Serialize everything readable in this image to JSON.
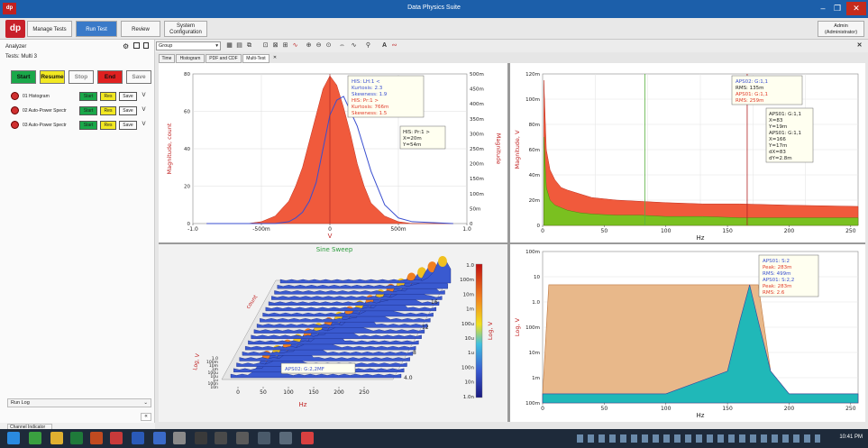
{
  "window": {
    "title": "Data Physics Suite",
    "logo": "dp"
  },
  "toolbar": {
    "tabs": [
      "Manage Tests",
      "Run Test",
      "Review",
      "System\nConfiguration"
    ],
    "admin": "Admin\n(Administrator)"
  },
  "left": {
    "analyzer": "Analyzer",
    "tests": "Tests: Multi 3",
    "buttons": {
      "start": "Start",
      "resume": "Resume",
      "stop": "Stop",
      "end": "End",
      "save": "Save"
    },
    "rows": [
      {
        "name": "01 Histogram",
        "run": "Start",
        "res": "Res",
        "save": "Save",
        "v": "V"
      },
      {
        "name": "02 Auto-Power Spectr",
        "run": "Start",
        "res": "Res",
        "save": "Save",
        "v": "V"
      },
      {
        "name": "03 Auto-Power Spectr",
        "run": "Start",
        "res": "Res",
        "save": "Save",
        "v": "V"
      }
    ],
    "run_log": "Run Log",
    "channel_indicator": "Channel Indicator"
  },
  "subtoolbar": {
    "group": "Group"
  },
  "view_tabs": [
    "Time",
    "Histogram",
    "PDF and CDF",
    "Multi-Test"
  ],
  "colors": {
    "hist": "#f05a3c",
    "blue": "#3a4fd0",
    "green": "#7ac020",
    "tan": "#e8b88a",
    "teal": "#20b8b8"
  },
  "chart_data": [
    {
      "type": "area",
      "xlabel": "V",
      "ylabel": "Magnitude, count",
      "y2label": "Magnitude",
      "xlim": [
        -1.0,
        1.0
      ],
      "ylim": [
        0,
        80
      ],
      "xticks": [
        "-1.0",
        "-500m",
        "0",
        "500m",
        "1.0"
      ],
      "yticks": [
        "0",
        "20",
        "40",
        "60",
        "80"
      ],
      "y2ticks": [
        "0",
        "50m",
        "100m",
        "150m",
        "200m",
        "250m",
        "300m",
        "350m",
        "400m",
        "450m",
        "500m"
      ],
      "legend": [
        {
          "label": "HIS: LH:1 <",
          "color": "#3a4fd0"
        },
        {
          "label": "Kurtosis: 2.3",
          "color": "#3a4fd0"
        },
        {
          "label": "Skewness: 1.9",
          "color": "#3a4fd0"
        },
        {
          "label": "HIS: Pr:1 >",
          "color": "#e03a2a"
        },
        {
          "label": "Kurtosis: 766m",
          "color": "#e03a2a"
        },
        {
          "label": "Skewness: 1.5",
          "color": "#e03a2a"
        }
      ],
      "cursor": [
        "HIS: Pr:1 >",
        "X=20m",
        "Y=54m"
      ],
      "x": [
        -0.9,
        -0.6,
        -0.5,
        -0.4,
        -0.3,
        -0.25,
        -0.2,
        -0.15,
        -0.1,
        -0.05,
        0,
        0.05,
        0.1,
        0.15,
        0.2,
        0.25,
        0.3,
        0.4,
        0.5,
        0.6,
        0.9
      ],
      "series": [
        {
          "name": "HIS: Pr:1",
          "values": [
            0,
            0,
            1,
            4,
            12,
            20,
            30,
            44,
            58,
            72,
            79,
            74,
            62,
            48,
            32,
            20,
            11,
            4,
            1,
            0,
            0
          ]
        },
        {
          "name": "HIS: LH:1",
          "values": [
            0,
            0,
            0,
            0,
            1,
            3,
            6,
            12,
            22,
            40,
            58,
            66,
            68,
            60,
            52,
            40,
            28,
            10,
            3,
            1,
            0
          ]
        }
      ]
    },
    {
      "type": "line",
      "xlabel": "Hz",
      "ylabel": "Magnitude, V",
      "xlim": [
        0,
        256
      ],
      "ylim": [
        0,
        120
      ],
      "xticks": [
        "0",
        "50",
        "100",
        "150",
        "200",
        "250"
      ],
      "yticks": [
        "0",
        "20m",
        "40m",
        "60m",
        "80m",
        "100m",
        "120m"
      ],
      "legend": [
        {
          "label": "APS02: G:1,1",
          "color": "#3a4fd0"
        },
        {
          "label": "RMS: 135m",
          "color": "#222222"
        },
        {
          "label": "APS01: G:1,1",
          "color": "#e03a2a"
        },
        {
          "label": "RMS: 259m",
          "color": "#e03a2a"
        }
      ],
      "cursor": [
        "APS01: G:1,1",
        "X=83",
        "Y=19m",
        "APS01: G:1,1",
        "X=166",
        "Y=17m",
        "dX=83",
        "dY=2.8m"
      ],
      "x": [
        1,
        3,
        6,
        10,
        15,
        20,
        30,
        40,
        60,
        80,
        100,
        130,
        160,
        200,
        256
      ],
      "series": [
        {
          "name": "APS01: G:1,1",
          "values": [
            115,
            60,
            44,
            36,
            30,
            28,
            25,
            22,
            20,
            19,
            18,
            17,
            17,
            16,
            15
          ]
        },
        {
          "name": "APS02: G:1,1",
          "values": [
            70,
            30,
            20,
            16,
            14,
            12,
            10,
            9,
            8,
            8,
            7,
            7,
            6,
            6,
            6
          ]
        }
      ]
    },
    {
      "type": "area",
      "title": "Sine Sweep",
      "xlabel": "Hz",
      "ylabel": "Log, V",
      "zlabel": "count",
      "xticks": [
        "0",
        "50",
        "100",
        "150",
        "200",
        "250"
      ],
      "yticks": [
        "4.0",
        "8",
        "12",
        "16"
      ],
      "zticks": [
        "10n",
        "100n",
        "1u",
        "10u",
        "100u",
        "1m",
        "10m",
        "100m",
        "1.0"
      ],
      "colorbar_label": "Log, V",
      "colorbar_ticks": [
        "1.0",
        "100m",
        "10m",
        "1m",
        "100u",
        "10u",
        "1u",
        "100n",
        "10n",
        "1.0n"
      ],
      "legend": [
        {
          "label": "APS02: G:2,2MF",
          "color": "#3a4fd0"
        }
      ]
    },
    {
      "type": "area",
      "xlabel": "Hz",
      "ylabel": "Log, V",
      "xlim": [
        0,
        256
      ],
      "xticks": [
        "0",
        "50",
        "100",
        "150",
        "200",
        "250"
      ],
      "yticks": [
        "100m",
        "1m",
        "10m",
        "100m",
        "1.0",
        "10",
        "100m"
      ],
      "legend": [
        {
          "label": "APS01: S:2",
          "color": "#3a4fd0"
        },
        {
          "label": "Peak: 283m",
          "color": "#e03a2a"
        },
        {
          "label": "RMS: 499m",
          "color": "#3a4fd0"
        },
        {
          "label": "APS01: S:2,2",
          "color": "#3a4fd0"
        },
        {
          "label": "Peak: 283m",
          "color": "#e03a2a"
        },
        {
          "label": "RMS: 2.6",
          "color": "#e03a2a"
        }
      ],
      "x": [
        0,
        5,
        10,
        20,
        100,
        150,
        160,
        168,
        175,
        185,
        200,
        256
      ],
      "series": [
        {
          "name": "APS01: S:2",
          "values": [
            -4,
            -1.6,
            -1.6,
            -1.6,
            -1.6,
            -1.6,
            -1.6,
            -1.6,
            -1.6,
            -3.5,
            -4,
            -4
          ]
        },
        {
          "name": "APS01: S:2,2",
          "values": [
            -4,
            -4,
            -4,
            -4,
            -4,
            -3.5,
            -2.4,
            -1.6,
            -2.4,
            -3.5,
            -4,
            -4
          ]
        }
      ]
    }
  ],
  "taskbar": {
    "time": "10:41 PM"
  }
}
